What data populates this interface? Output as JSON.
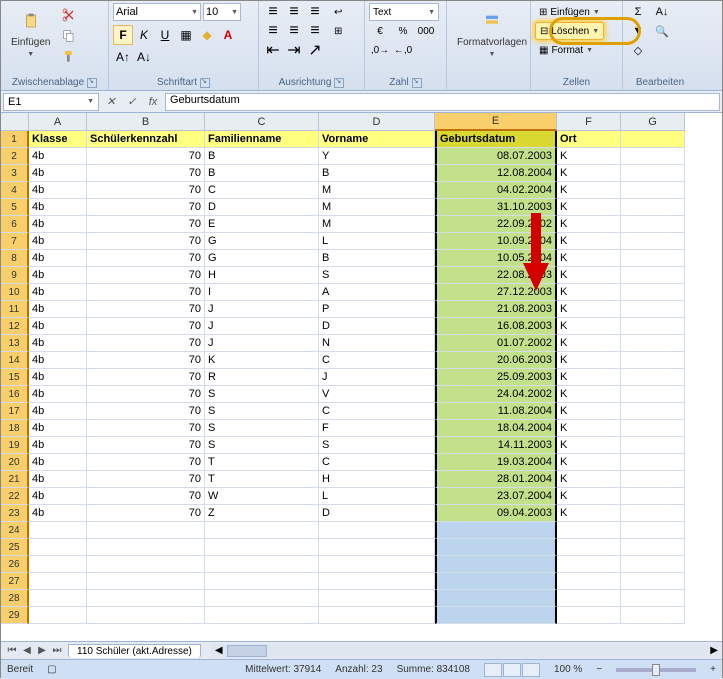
{
  "ribbon": {
    "clipboard": {
      "paste": "Einfügen",
      "label": "Zwischenablage"
    },
    "font": {
      "name": "Arial",
      "size": "10",
      "label": "Schriftart"
    },
    "align": {
      "label": "Ausrichtung"
    },
    "number": {
      "format": "Text",
      "label": "Zahl"
    },
    "styles": {
      "label": "Formatvorlagen"
    },
    "cells": {
      "insert": "Einfügen",
      "delete": "Löschen",
      "format": "Format",
      "label": "Zellen"
    },
    "editing": {
      "label": "Bearbeiten"
    }
  },
  "formula": {
    "ref": "E1",
    "value": "Geburtsdatum"
  },
  "cols": [
    "A",
    "B",
    "C",
    "D",
    "E",
    "F",
    "G"
  ],
  "headers": {
    "A": "Klasse",
    "B": "Schülerkennzahl",
    "C": "Familienname",
    "D": "Vorname",
    "E": "Geburtsdatum",
    "F": "Ort"
  },
  "rows": [
    {
      "n": 2,
      "A": "4b",
      "B": "70",
      "C": "B",
      "D": "Y",
      "E": "08.07.2003",
      "F": "K"
    },
    {
      "n": 3,
      "A": "4b",
      "B": "70",
      "C": "B",
      "D": "B",
      "E": "12.08.2004",
      "F": "K"
    },
    {
      "n": 4,
      "A": "4b",
      "B": "70",
      "C": "C",
      "D": "M",
      "E": "04.02.2004",
      "F": "K"
    },
    {
      "n": 5,
      "A": "4b",
      "B": "70",
      "C": "D",
      "D": "M",
      "E": "31.10.2003",
      "F": "K"
    },
    {
      "n": 6,
      "A": "4b",
      "B": "70",
      "C": "E",
      "D": "M",
      "E": "22.09.2002",
      "F": "K"
    },
    {
      "n": 7,
      "A": "4b",
      "B": "70",
      "C": "G",
      "D": "L",
      "E": "10.09.2004",
      "F": "K"
    },
    {
      "n": 8,
      "A": "4b",
      "B": "70",
      "C": "G",
      "D": "B",
      "E": "10.05.2004",
      "F": "K"
    },
    {
      "n": 9,
      "A": "4b",
      "B": "70",
      "C": "H",
      "D": "S",
      "E": "22.08.2003",
      "F": "K"
    },
    {
      "n": 10,
      "A": "4b",
      "B": "70",
      "C": "I",
      "D": "A",
      "E": "27.12.2003",
      "F": "K"
    },
    {
      "n": 11,
      "A": "4b",
      "B": "70",
      "C": "J",
      "D": "P",
      "E": "21.08.2003",
      "F": "K"
    },
    {
      "n": 12,
      "A": "4b",
      "B": "70",
      "C": "J",
      "D": "D",
      "E": "16.08.2003",
      "F": "K"
    },
    {
      "n": 13,
      "A": "4b",
      "B": "70",
      "C": "J",
      "D": "N",
      "E": "01.07.2002",
      "F": "K"
    },
    {
      "n": 14,
      "A": "4b",
      "B": "70",
      "C": "K",
      "D": "C",
      "E": "20.06.2003",
      "F": "K"
    },
    {
      "n": 15,
      "A": "4b",
      "B": "70",
      "C": "R",
      "D": "J",
      "E": "25.09.2003",
      "F": "K"
    },
    {
      "n": 16,
      "A": "4b",
      "B": "70",
      "C": "S",
      "D": "V",
      "E": "24.04.2002",
      "F": "K"
    },
    {
      "n": 17,
      "A": "4b",
      "B": "70",
      "C": "S",
      "D": "C",
      "E": "11.08.2004",
      "F": "K"
    },
    {
      "n": 18,
      "A": "4b",
      "B": "70",
      "C": "S",
      "D": "F",
      "E": "18.04.2004",
      "F": "K"
    },
    {
      "n": 19,
      "A": "4b",
      "B": "70",
      "C": "S",
      "D": "S",
      "E": "14.11.2003",
      "F": "K"
    },
    {
      "n": 20,
      "A": "4b",
      "B": "70",
      "C": "T",
      "D": "C",
      "E": "19.03.2004",
      "F": "K"
    },
    {
      "n": 21,
      "A": "4b",
      "B": "70",
      "C": "T",
      "D": "H",
      "E": "28.01.2004",
      "F": "K"
    },
    {
      "n": 22,
      "A": "4b",
      "B": "70",
      "C": "W",
      "D": "L",
      "E": "23.07.2004",
      "F": "K"
    },
    {
      "n": 23,
      "A": "4b",
      "B": "70",
      "C": "Z",
      "D": "D",
      "E": "09.04.2003",
      "F": "K"
    }
  ],
  "empty_rows": [
    24,
    25,
    26,
    27,
    28,
    29
  ],
  "sheet": {
    "name": "110 Schüler (akt.Adresse)"
  },
  "status": {
    "ready": "Bereit",
    "avg": "Mittelwert: 37914",
    "count": "Anzahl: 23",
    "sum": "Summe: 834108",
    "zoom": "100 %"
  }
}
